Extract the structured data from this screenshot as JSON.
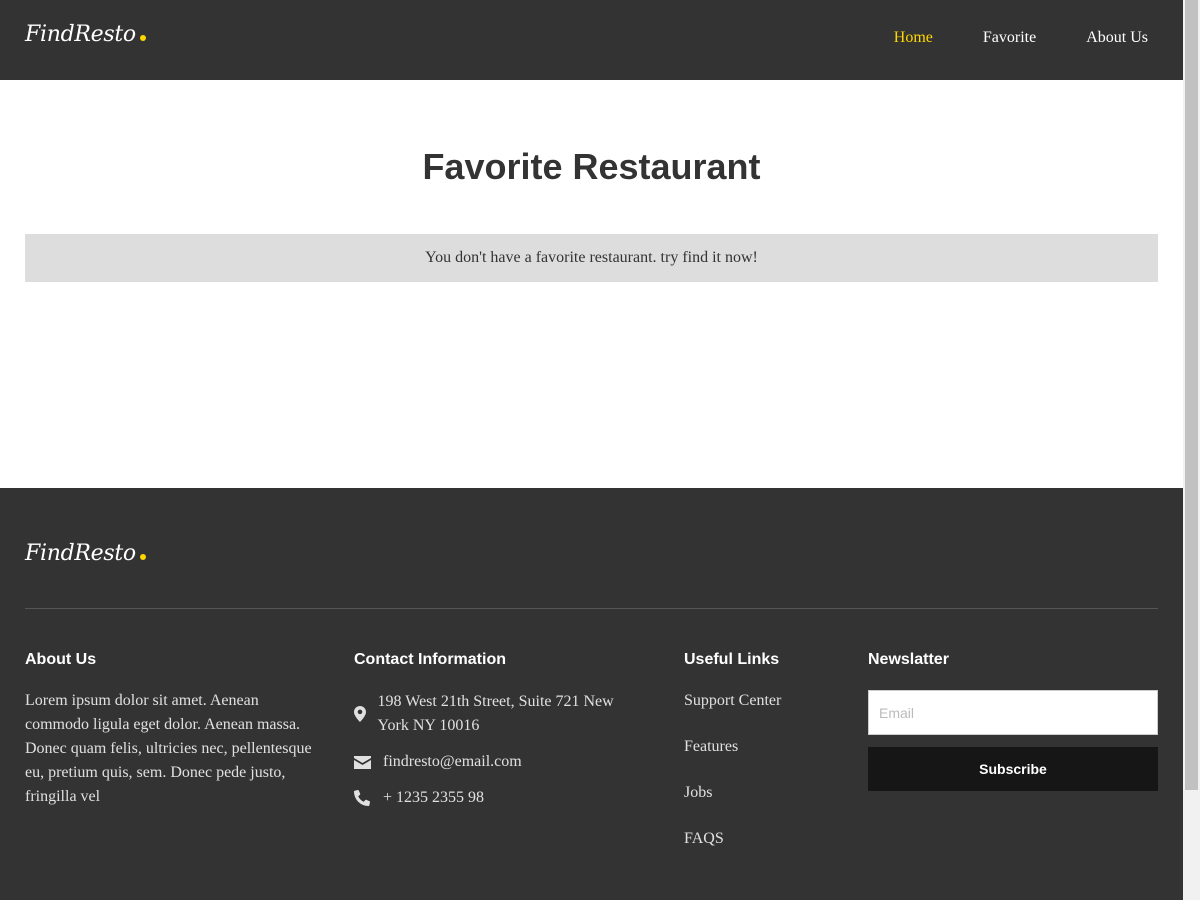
{
  "brand": {
    "name": "FindResto",
    "dot_color": "#FFD600"
  },
  "nav": {
    "items": [
      {
        "label": "Home",
        "active": true
      },
      {
        "label": "Favorite",
        "active": false
      },
      {
        "label": "About Us",
        "active": false
      }
    ],
    "active_color": "#FFD600"
  },
  "main": {
    "title": "Favorite Restaurant",
    "empty_message": "You don't have a favorite restaurant. try find it now!"
  },
  "footer": {
    "about": {
      "title": "About Us",
      "text": "Lorem ipsum dolor sit amet. Aenean commodo ligula eget dolor. Aenean massa. Donec quam felis, ultricies nec, pellentesque eu, pretium quis, sem. Donec pede justo, fringilla vel"
    },
    "contact": {
      "title": "Contact Information",
      "address": "198 West 21th Street, Suite 721 New York NY 10016",
      "email": "findresto@email.com",
      "phone": "+ 1235 2355 98",
      "icons": [
        "map-pin-icon",
        "envelope-icon",
        "phone-icon"
      ]
    },
    "links": {
      "title": "Useful Links",
      "items": [
        "Support Center",
        "Features",
        "Jobs",
        "FAQS"
      ]
    },
    "newsletter": {
      "title": "Newslatter",
      "placeholder": "Email",
      "value": "",
      "button_label": "Subscribe"
    }
  },
  "colors": {
    "dark_bg": "#333333",
    "empty_box_bg": "#dddddd",
    "button_bg": "#161616"
  }
}
